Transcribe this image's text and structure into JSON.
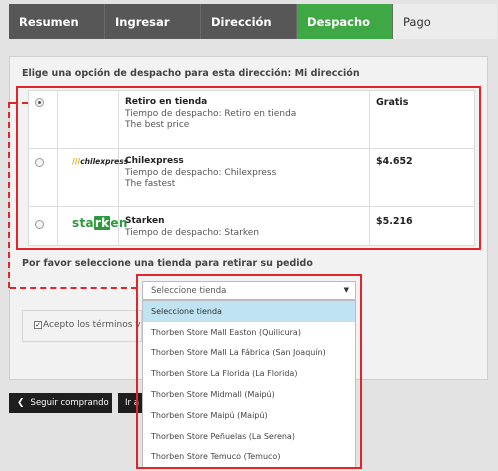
{
  "tabs": [
    {
      "label": "Resumen"
    },
    {
      "label": "Ingresar"
    },
    {
      "label": "Dirección"
    },
    {
      "label": "Despacho"
    },
    {
      "label": "Pago"
    }
  ],
  "shipping": {
    "heading": "Elige una opción de despacho para esta dirección: Mi dirección",
    "options": [
      {
        "name": "Retiro en tienda",
        "time": "Tiempo de despacho: Retiro en tienda",
        "note": "The best price",
        "price": "Gratis",
        "selected": true
      },
      {
        "name": "Chilexpress",
        "time": "Tiempo de despacho: Chilexpress",
        "note": "The fastest",
        "price": "$4.652",
        "logo": "chilexpress"
      },
      {
        "name": "Starken",
        "time": "Tiempo de despacho: Starken",
        "price": "$5.216"
      }
    ]
  },
  "store": {
    "label": "Por favor seleccione una tienda para retirar su pedido",
    "selected": "Seleccione tienda",
    "options": [
      "Seleccione tienda",
      "Thorben Store Mall Easton (Quilicura)",
      "Thorben Store Mall La Fábrica (San Joaquín)",
      "Thorben Store La Florida (La Florida)",
      "Thorben Store Midmall (Maipú)",
      "Thorben Store Maipú (Maipú)",
      "Thorben Store Peñuelas (La Serena)",
      "Thorben Store Temuco (Temuco)"
    ]
  },
  "terms": {
    "label": "Acepto los términos y c"
  },
  "buttons": {
    "continue_shopping": "Seguir comprando",
    "next": "Ir a"
  },
  "starken_logo": {
    "before": "sta",
    "box": "rk",
    "after": "en"
  },
  "colors": {
    "active_tab": "#3ea944",
    "annotation": "#e0262a",
    "highlight": "#bfe3f2"
  }
}
